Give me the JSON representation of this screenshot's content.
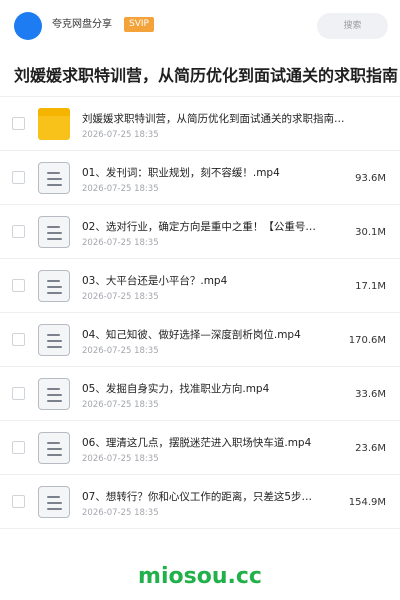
{
  "header": {
    "username": "夸克网盘分享",
    "vip_badge": "SVIP",
    "search_placeholder": "搜索"
  },
  "title": "刘媛媛求职特训营，从简历优化到面试通关的求职指南（第",
  "files": [
    {
      "type": "folder",
      "name": "刘媛媛求职特训营，从简历优化到面试通关的求职指南（…",
      "date": "2026-07-25 18:35",
      "size": ""
    },
    {
      "type": "video",
      "name": "01、发刊词：职业规划，刻不容缓！.mp4",
      "date": "2026-07-25 18:35",
      "size": "93.6M"
    },
    {
      "type": "video",
      "name": "02、选对行业，确定方向是重中之重！【公重号：Cu…",
      "date": "2026-07-25 18:35",
      "size": "30.1M"
    },
    {
      "type": "video",
      "name": "03、大平台还是小平台？.mp4",
      "date": "2026-07-25 18:35",
      "size": "17.1M"
    },
    {
      "type": "video",
      "name": "04、知己知彼、做好选择—深度剖析岗位.mp4",
      "date": "2026-07-25 18:35",
      "size": "170.6M"
    },
    {
      "type": "video",
      "name": "05、发掘自身实力，找准职业方向.mp4",
      "date": "2026-07-25 18:35",
      "size": "33.6M"
    },
    {
      "type": "video",
      "name": "06、理清这几点，摆脱迷茫进入职场快车道.mp4",
      "date": "2026-07-25 18:35",
      "size": "23.6M"
    },
    {
      "type": "video",
      "name": "07、想转行？你和心仪工作的距离，只差这5步！.m…",
      "date": "2026-07-25 18:35",
      "size": "154.9M"
    }
  ],
  "watermark": "miosou.cc",
  "colors": {
    "accent_blue": "#1e7cf2",
    "vip_orange": "#f3a33a",
    "folder_yellow": "#f9c21a",
    "watermark_green": "#22b04b"
  },
  "icons": {
    "folder": "folder-icon",
    "video": "file-doc-icon"
  }
}
